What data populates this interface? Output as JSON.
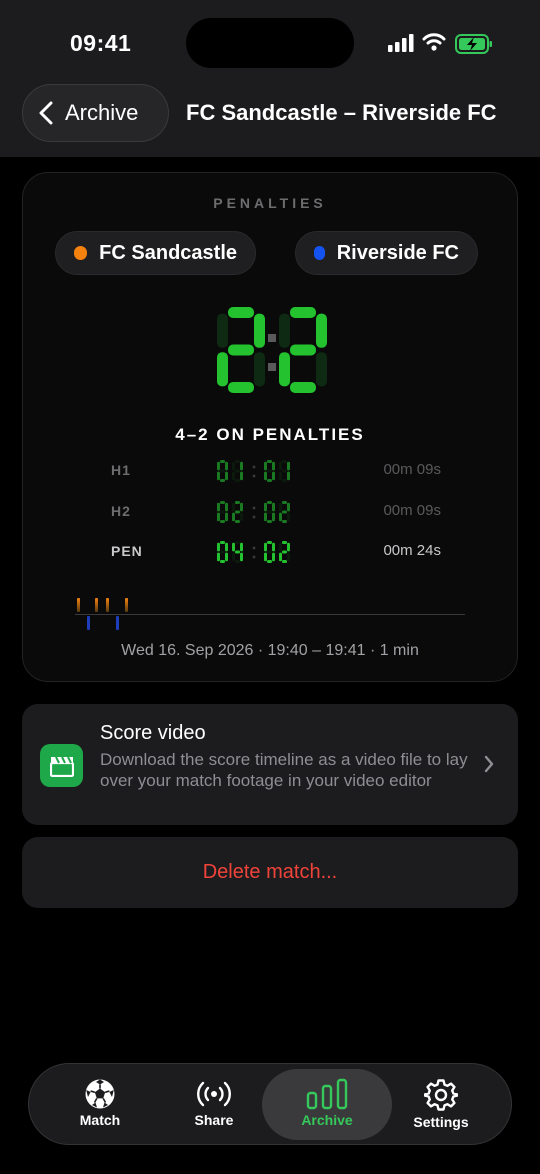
{
  "status_bar": {
    "time": "09:41"
  },
  "nav": {
    "back_label": "Archive",
    "title": "FC Sandcastle – Riverside FC"
  },
  "scoreboard": {
    "kicker": "PENALTIES",
    "team_a": {
      "name": "FC Sandcastle",
      "color": "#f5820f"
    },
    "team_b": {
      "name": "Riverside FC",
      "color": "#1553f0"
    },
    "score_a": "2",
    "score_b": "2",
    "result": "4–2 ON PENALTIES",
    "periods": [
      {
        "label": "H1",
        "score_a": "01",
        "score_b": "01",
        "duration": "00m 09s"
      },
      {
        "label": "H2",
        "score_a": "02",
        "score_b": "02",
        "duration": "00m 09s"
      },
      {
        "label": "PEN",
        "score_a": "04",
        "score_b": "02",
        "duration": "00m 24s"
      }
    ],
    "date_line": "Wed 16. Sep 2026 · 19:40 – 19:41 · 1 min",
    "digit_color": "#23c22e"
  },
  "score_video": {
    "title": "Score video",
    "subtitle": "Download the score timeline as a video file to lay over your match footage in your video editor",
    "icon": "clapperboard-icon"
  },
  "delete_label": "Delete match...",
  "tabs": [
    {
      "label": "Match",
      "icon": "soccer-ball-icon",
      "active": false
    },
    {
      "label": "Share",
      "icon": "broadcast-icon",
      "active": false
    },
    {
      "label": "Archive",
      "icon": "bar-chart-icon",
      "active": true
    },
    {
      "label": "Settings",
      "icon": "gear-icon",
      "active": false
    }
  ]
}
